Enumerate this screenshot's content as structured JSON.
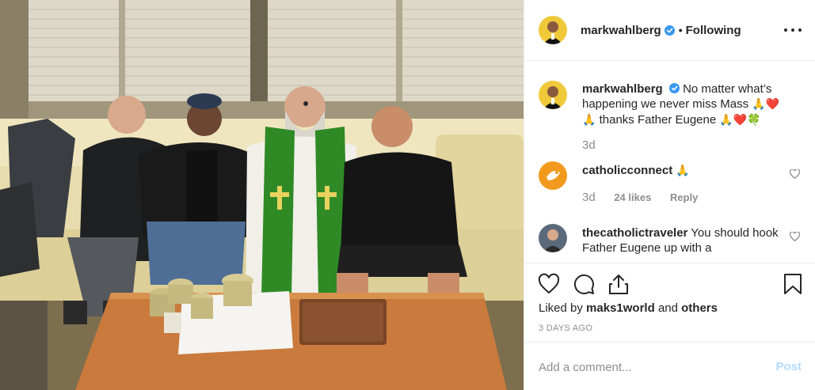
{
  "post": {
    "username": "markwahlberg",
    "follow_status": "Following",
    "more_label": "More options"
  },
  "caption": {
    "username": "markwahlberg",
    "text_line1": "No matter what’s happening we never miss Mass",
    "emoji_1": "🙏❤️",
    "emoji_2": "🙏",
    "text_line2": "thanks Father Eugene",
    "emoji_3": "🙏❤️🍀",
    "age": "3d"
  },
  "comments": [
    {
      "username": "catholicconnect",
      "text": "🙏",
      "age": "3d",
      "likes": "24 likes",
      "reply": "Reply"
    },
    {
      "username": "thecatholictraveler",
      "text": "You should hook Father Eugene up with a"
    }
  ],
  "actions": {
    "liked_by_prefix": "Liked by",
    "liked_by_user": "maks1world",
    "and": "and",
    "others": "others",
    "date": "3 DAYS AGO"
  },
  "composer": {
    "placeholder": "Add a comment...",
    "post_label": "Post"
  },
  "icons": {
    "verified": "verified-badge-icon",
    "like": "heart-icon",
    "comment": "comment-bubble-icon",
    "share": "share-icon",
    "save": "bookmark-icon",
    "more": "ellipsis-icon"
  },
  "colors": {
    "verified_blue": "#3897f0",
    "post_disabled": "#b3dbff",
    "muted": "#8e8e8e",
    "text": "#262626",
    "stole_green": "#2f8a26",
    "table_wood": "#c97a3c"
  }
}
